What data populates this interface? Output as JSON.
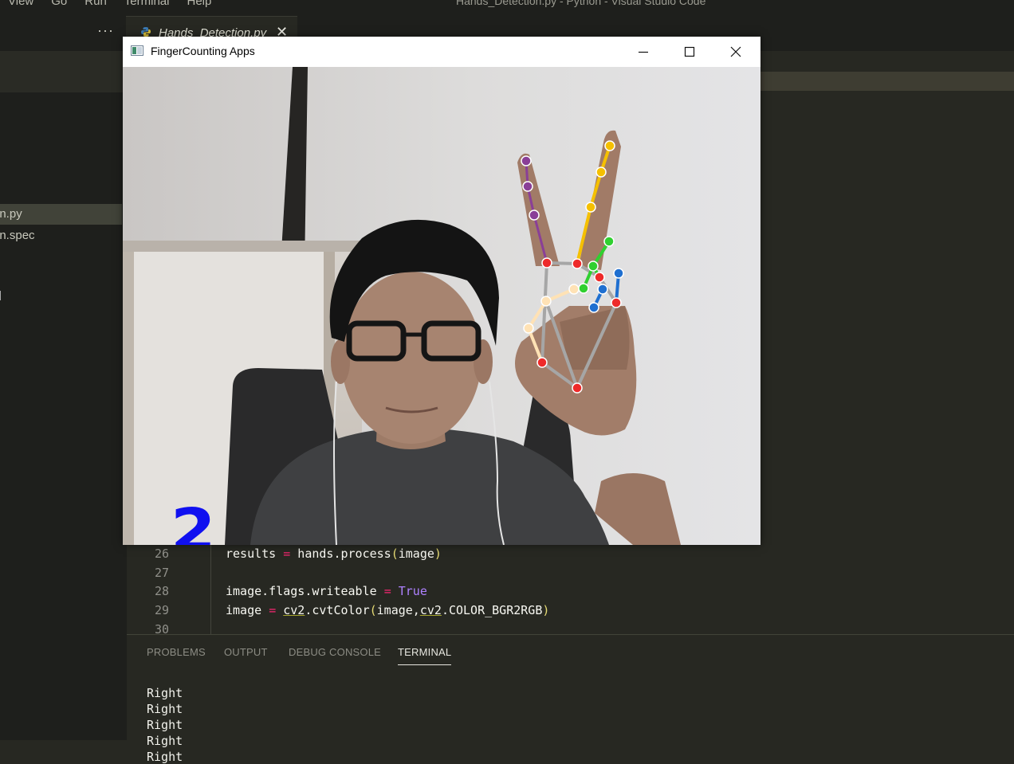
{
  "vscode": {
    "menu": [
      "View",
      "Go",
      "Run",
      "Terminal",
      "Help"
    ],
    "window_title": "Hands_Detection.py - Python - Visual Studio Code",
    "sidebar": {
      "more_icon": "ellipsis-icon",
      "files": [
        "on.py",
        "on.spec"
      ]
    },
    "tab": {
      "label": "Hands_Detection.py",
      "icon": "python-icon"
    },
    "line_numbers": [
      "26",
      "27",
      "28",
      "29",
      "30"
    ],
    "code": {
      "l26": {
        "a": "results ",
        "op": "=",
        "b": " hands.process",
        "p1": "(",
        "c": "image",
        "p2": ")"
      },
      "l28": {
        "a": "image.flags.writeable ",
        "op": "=",
        "kw": " True"
      },
      "l29": {
        "a": "image ",
        "op": "=",
        "mod1": "cv2",
        "b": ".cvtColor",
        "p1": "(",
        "c": "image,",
        "mod2": "cv2",
        "d": ".COLOR_BGR2RGB",
        "p2": ")"
      }
    },
    "panel": {
      "tabs": [
        "PROBLEMS",
        "OUTPUT",
        "DEBUG CONSOLE",
        "TERMINAL"
      ],
      "active_tab": "TERMINAL",
      "terminal_lines": [
        "Right",
        "Right",
        "Right",
        "Right",
        "Right"
      ]
    },
    "colors": {
      "bg": "#272822",
      "sidebar": "#1e1f1c",
      "keyword": "#ae81ff",
      "operator": "#f92672",
      "bracket": "#e6db74"
    }
  },
  "cv_window": {
    "title": "FingerCounting Apps",
    "controls": [
      "minimize-icon",
      "maximize-icon",
      "close-icon"
    ],
    "finger_count": "2",
    "count_color": "#1010f0",
    "landmark_colors": {
      "wrist_palm": "#ee2a2a",
      "thumb": "#ffe0b0",
      "index": "#f5c000",
      "middle": "#8a3f97",
      "ring": "#30d030",
      "pinky": "#1f6fd0",
      "bones": "#a6a6a6"
    }
  }
}
